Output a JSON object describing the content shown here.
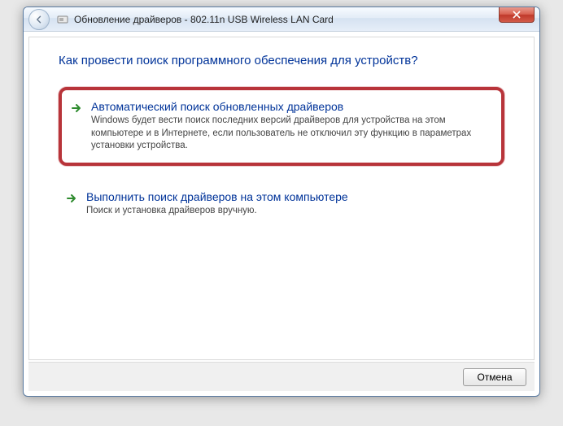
{
  "titlebar": {
    "title": "Обновление драйверов - 802.11n USB Wireless LAN Card"
  },
  "heading": "Как провести поиск программного обеспечения для устройств?",
  "options": [
    {
      "title": "Автоматический поиск обновленных драйверов",
      "desc": "Windows будет вести поиск последних версий драйверов для устройства на этом компьютере и в Интернете, если пользователь не отключил эту функцию в параметрах установки устройства."
    },
    {
      "title": "Выполнить поиск драйверов на этом компьютере",
      "desc": "Поиск и установка драйверов вручную."
    }
  ],
  "footer": {
    "cancel": "Отмена"
  }
}
